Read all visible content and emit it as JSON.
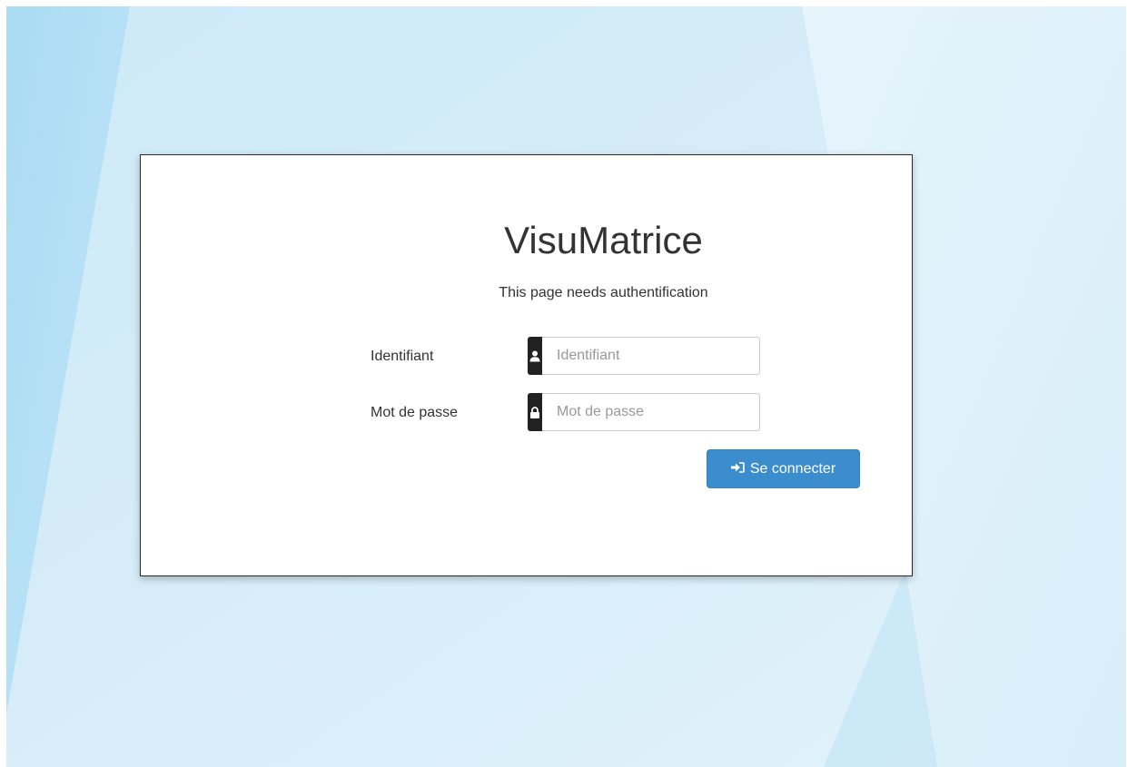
{
  "app": {
    "title": "VisuMatrice",
    "subtitle": "This page needs authentification"
  },
  "form": {
    "username": {
      "label": "Identifiant",
      "placeholder": "Identifiant",
      "value": "",
      "icon": "user-icon"
    },
    "password": {
      "label": "Mot de passe",
      "placeholder": "Mot de passe",
      "value": "",
      "icon": "lock-icon"
    },
    "submit": {
      "label": "Se connecter",
      "icon": "sign-in-icon"
    }
  },
  "colors": {
    "button": "#3c8dcd",
    "addon": "#222222",
    "background": "#d4ecf8"
  }
}
